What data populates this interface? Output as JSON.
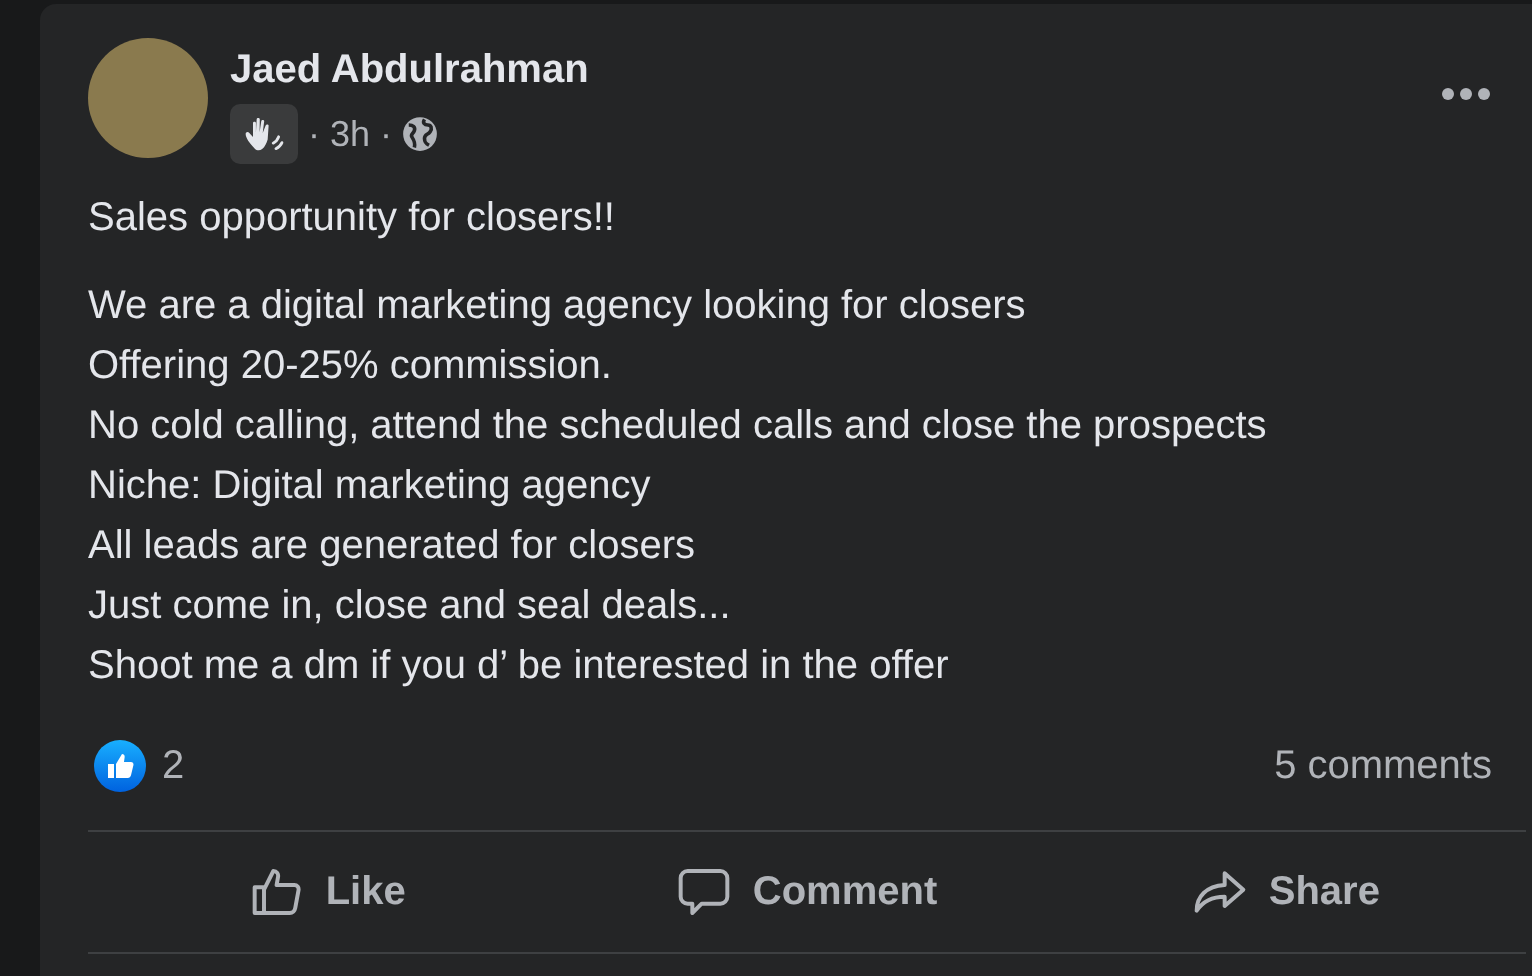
{
  "post": {
    "author": "Jaed Abdulrahman",
    "meta": "· 3h ·",
    "headline": "Sales opportunity for closers!!",
    "lines": [
      "We are a digital marketing agency looking for closers",
      "Offering 20-25% commission.",
      "No cold calling, attend the scheduled calls and close the prospects",
      "Niche: Digital marketing agency",
      "All leads are generated for closers",
      "Just come in, close and seal deals...",
      "Shoot me a dm if you d’ be interested in the offer"
    ],
    "reaction_count": "2",
    "comments_count": "5 comments",
    "actions": [
      {
        "kind": "like",
        "label": "Like"
      },
      {
        "kind": "comment",
        "label": "Comment"
      },
      {
        "kind": "share",
        "label": "Share"
      }
    ]
  }
}
